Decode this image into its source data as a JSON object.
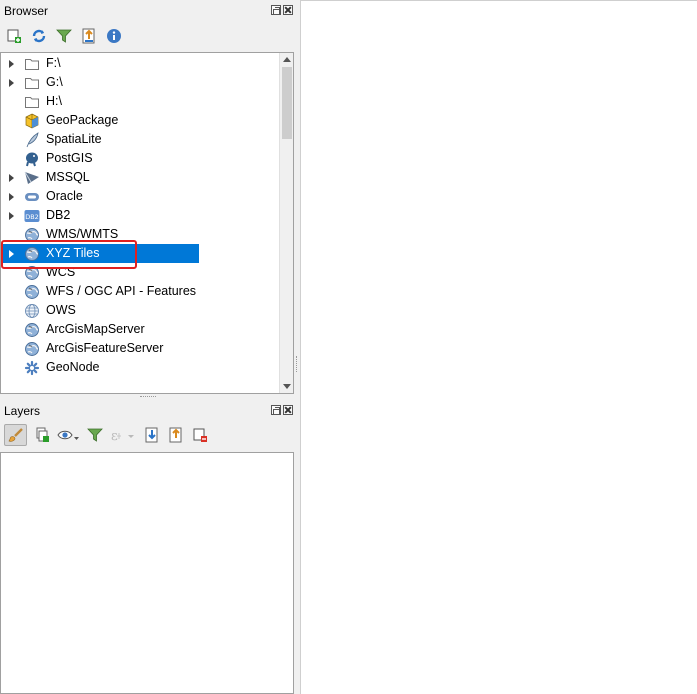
{
  "browser": {
    "title": "Browser",
    "toolbar": [
      "add-selected-layers",
      "refresh",
      "filter-browser",
      "collapse-all",
      "properties"
    ],
    "items": [
      {
        "label": "F:\\",
        "icon": "folder-icon",
        "expandable": true
      },
      {
        "label": "G:\\",
        "icon": "folder-icon",
        "expandable": true
      },
      {
        "label": "H:\\",
        "icon": "folder-icon",
        "expandable": false
      },
      {
        "label": "GeoPackage",
        "icon": "geopackage-icon",
        "expandable": false
      },
      {
        "label": "SpatiaLite",
        "icon": "spatialite-icon",
        "expandable": false
      },
      {
        "label": "PostGIS",
        "icon": "postgis-icon",
        "expandable": false
      },
      {
        "label": "MSSQL",
        "icon": "mssql-icon",
        "expandable": true
      },
      {
        "label": "Oracle",
        "icon": "oracle-icon",
        "expandable": true
      },
      {
        "label": "DB2",
        "icon": "db2-icon",
        "expandable": true
      },
      {
        "label": "WMS/WMTS",
        "icon": "globe-icon",
        "expandable": false
      },
      {
        "label": "XYZ Tiles",
        "icon": "globe-icon",
        "expandable": true,
        "selected": true
      },
      {
        "label": "WCS",
        "icon": "globe-icon",
        "expandable": false
      },
      {
        "label": "WFS / OGC API - Features",
        "icon": "globe-icon",
        "expandable": false
      },
      {
        "label": "OWS",
        "icon": "globe-outline-icon",
        "expandable": false
      },
      {
        "label": "ArcGisMapServer",
        "icon": "globe-icon",
        "expandable": false
      },
      {
        "label": "ArcGisFeatureServer",
        "icon": "globe-icon",
        "expandable": false
      },
      {
        "label": "GeoNode",
        "icon": "geonode-icon",
        "expandable": false
      }
    ]
  },
  "layers": {
    "title": "Layers"
  },
  "colors": {
    "selection": "#0078d7",
    "highlight": "#e02020"
  }
}
